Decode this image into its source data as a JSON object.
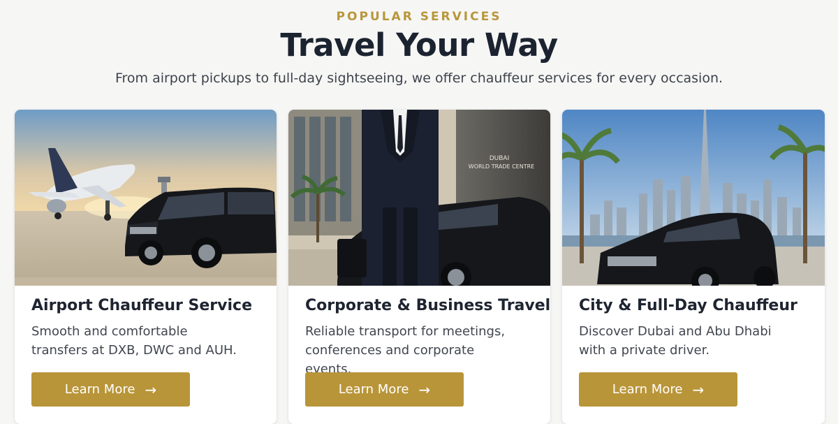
{
  "header": {
    "eyebrow": "POPULAR SERVICES",
    "title": "Travel Your Way",
    "subtitle": "From airport pickups to full-day sightseeing, we offer chauffeur services for every occasion."
  },
  "cards": [
    {
      "title": "Airport Chauffeur Service",
      "description": "Smooth and comfortable transfers at DXB, DWC and AUH.",
      "button_label": "Learn More",
      "button_icon": "arrow-right-icon",
      "image": "airplane-and-black-van-photo"
    },
    {
      "title": "Corporate & Business Travel",
      "description": "Reliable transport for meetings, conferences and corporate events.",
      "button_label": "Learn More",
      "button_icon": "arrow-right-icon",
      "image": "businessman-and-sedan-photo",
      "photo_sign_line1": "DUBAI",
      "photo_sign_line2": "WORLD TRADE CENTRE"
    },
    {
      "title": "City & Full-Day Chauffeur",
      "description": "Discover Dubai and Abu Dhabi with a private driver.",
      "button_label": "Learn More",
      "button_icon": "arrow-right-icon",
      "image": "dubai-skyline-sedan-photo"
    }
  ],
  "colors": {
    "accent": "#b99539",
    "eyebrow": "#b8963b",
    "heading": "#1c2330",
    "background": "#f6f6f5"
  }
}
